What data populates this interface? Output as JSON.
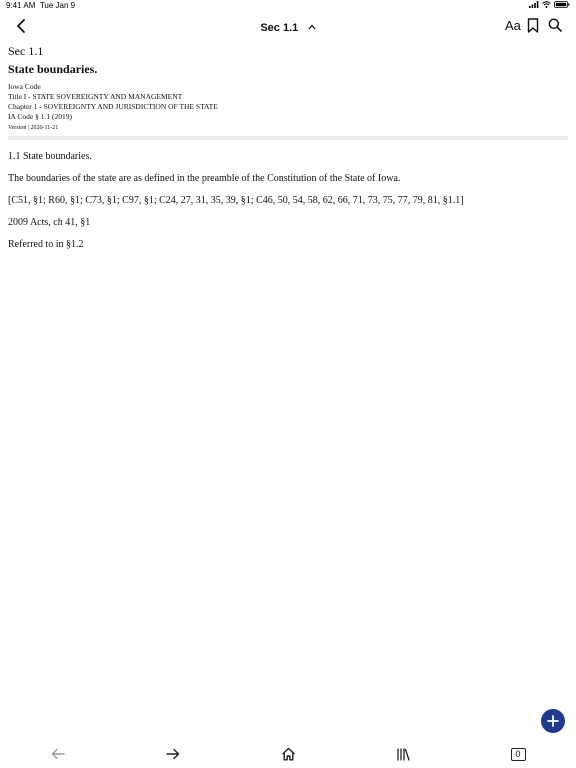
{
  "status_bar": {
    "time": "9:41 AM",
    "date": "Tue Jan 9"
  },
  "nav": {
    "title": "Sec 1.1",
    "font_button": "Aa"
  },
  "document": {
    "section_label": "Sec 1.1",
    "title": "State boundaries.",
    "meta": [
      "Iowa Code",
      "Title I - STATE SOVEREIGNTY AND MANAGEMENT",
      "Chapter 1 - SOVEREIGNTY AND JURISDICTION OF THE STATE",
      "IA Code § 1.1 (2019)"
    ],
    "version": "Version | 2020-11-21",
    "paragraphs": [
      "1.1 State boundaries.",
      "The boundaries of the state are as defined in the preamble of the Constitution of the State of Iowa.",
      "[C51, §1; R60, §1; C73, §1; C97, §1; C24, 27, 31, 35, 39, §1; C46, 50, 54, 58, 62, 66, 71, 73, 75, 77, 79, 81, §1.1]",
      "2009 Acts, ch 41, §1",
      "Referred to in §1.2"
    ]
  },
  "toolbar": {
    "tab_count": "0"
  },
  "colors": {
    "accent": "#1f3a8a",
    "divider": "#eeeeee"
  },
  "icons": [
    "back-chevron-icon",
    "chevron-up-icon",
    "bookmark-icon",
    "search-icon",
    "plus-icon",
    "arrow-left-icon",
    "arrow-right-icon",
    "home-icon",
    "library-icon",
    "tabs-icon"
  ]
}
